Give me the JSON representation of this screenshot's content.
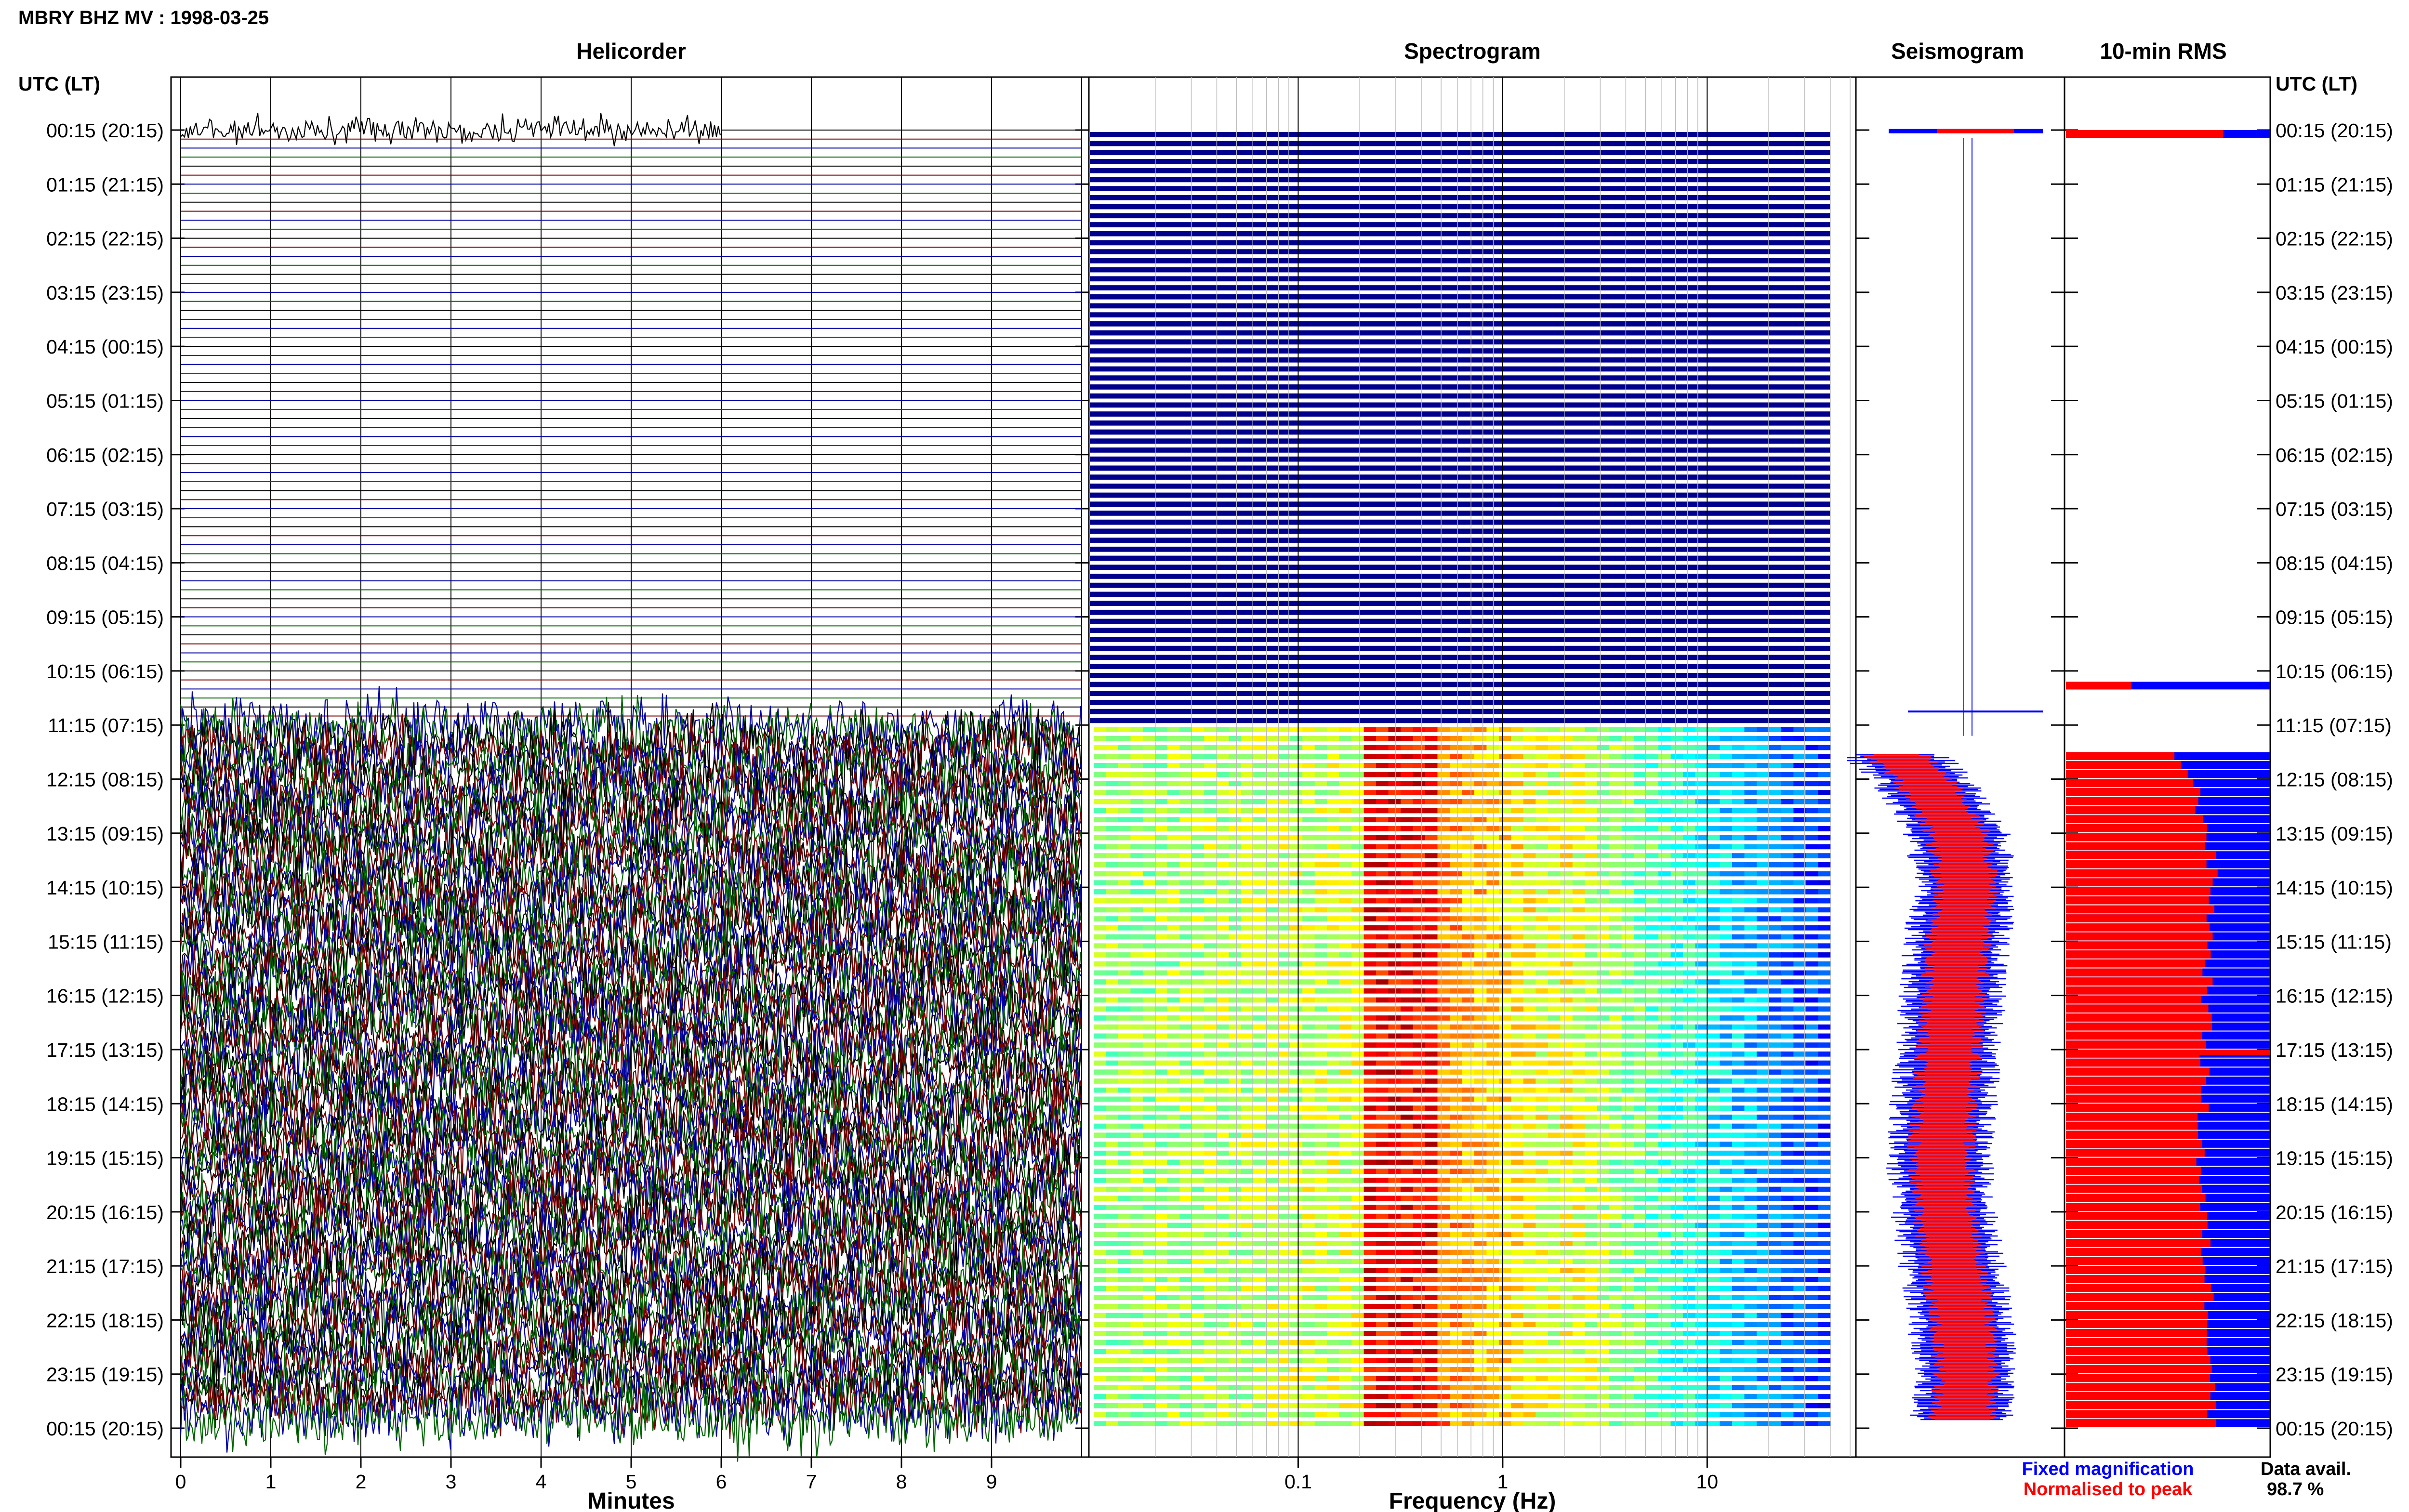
{
  "title": "MBRY BHZ MV : 1998-03-25",
  "panel_titles": {
    "helicorder": "Helicorder",
    "spectrogram": "Spectrogram",
    "seismogram": "Seismogram",
    "rms": "10-min RMS"
  },
  "time_axis_label": "UTC (LT)",
  "legend": {
    "fixed": "Fixed magnification",
    "normalised": "Normalised to peak",
    "data_avail_label": "Data avail.",
    "data_avail_value": "98.7 %"
  },
  "colors": {
    "helicorder_lines": [
      "#000000",
      "#7a0000",
      "#0000a0",
      "#006400"
    ],
    "fixed_magnification": "#0000ff",
    "normalised_to_peak": "#ff0000",
    "spectrogram_background": "#00008c"
  },
  "chart_data": {
    "type": "multi-panel seismic day plot",
    "station": "MBRY",
    "channel": "BHZ",
    "network": "MV",
    "date": "1998-03-25",
    "y_tick_labels": [
      "00:15 (20:15)",
      "01:15 (21:15)",
      "02:15 (22:15)",
      "03:15 (23:15)",
      "04:15 (00:15)",
      "05:15 (01:15)",
      "06:15 (02:15)",
      "07:15 (03:15)",
      "08:15 (04:15)",
      "09:15 (05:15)",
      "10:15 (06:15)",
      "11:15 (07:15)",
      "12:15 (08:15)",
      "13:15 (09:15)",
      "14:15 (10:15)",
      "15:15 (11:15)",
      "16:15 (12:15)",
      "17:15 (13:15)",
      "18:15 (14:15)",
      "19:15 (15:15)",
      "20:15 (16:15)",
      "21:15 (17:15)",
      "22:15 (18:15)",
      "23:15 (19:15)",
      "00:15 (20:15)"
    ],
    "helicorder": {
      "xlabel": "Minutes",
      "x_ticks": [
        "0",
        "1",
        "2",
        "3",
        "4",
        "5",
        "6",
        "7",
        "8",
        "9"
      ],
      "xlim": [
        0,
        10
      ],
      "lines_per_hour": 6,
      "line_minutes": 10,
      "data_segments": [
        {
          "start_hour": 0.0,
          "end_hour": 0.1,
          "level": "low"
        },
        {
          "start_hour": 10.4,
          "end_hour": 10.42,
          "level": "low"
        },
        {
          "start_hour": 11.0,
          "end_hour": 24.0,
          "level": "high"
        }
      ]
    },
    "spectrogram": {
      "xlabel": "Frequency (Hz)",
      "x_scale": "log",
      "x_ticks": [
        "0.1",
        "1",
        "10"
      ],
      "xlim": [
        0.01,
        50
      ],
      "colormap": "jet",
      "dominant_band_hz": [
        0.2,
        0.5
      ]
    },
    "seismogram": {
      "series": [
        {
          "name": "Fixed magnification",
          "color": "#0000ff"
        },
        {
          "name": "Normalised to peak",
          "color": "#ff0000"
        }
      ]
    },
    "rms_10min": {
      "title": "10-min RMS",
      "blue_interval_starts_hours": [
        0.0,
        10.2,
        11.5
      ],
      "red_interval_starts_hours": [
        0.0,
        10.2,
        11.5
      ],
      "red_profile_hours": [
        11.5,
        12.0,
        13.0,
        14.0,
        15.0,
        16.0,
        17.0,
        18.0,
        19.0,
        20.0,
        21.0,
        22.0,
        23.0,
        23.85
      ],
      "red_profile_values": [
        0.55,
        0.62,
        0.7,
        0.72,
        0.7,
        0.69,
        0.68,
        0.67,
        0.66,
        0.67,
        0.69,
        0.71,
        0.72,
        0.71
      ]
    },
    "data_availability_percent": 98.7
  }
}
